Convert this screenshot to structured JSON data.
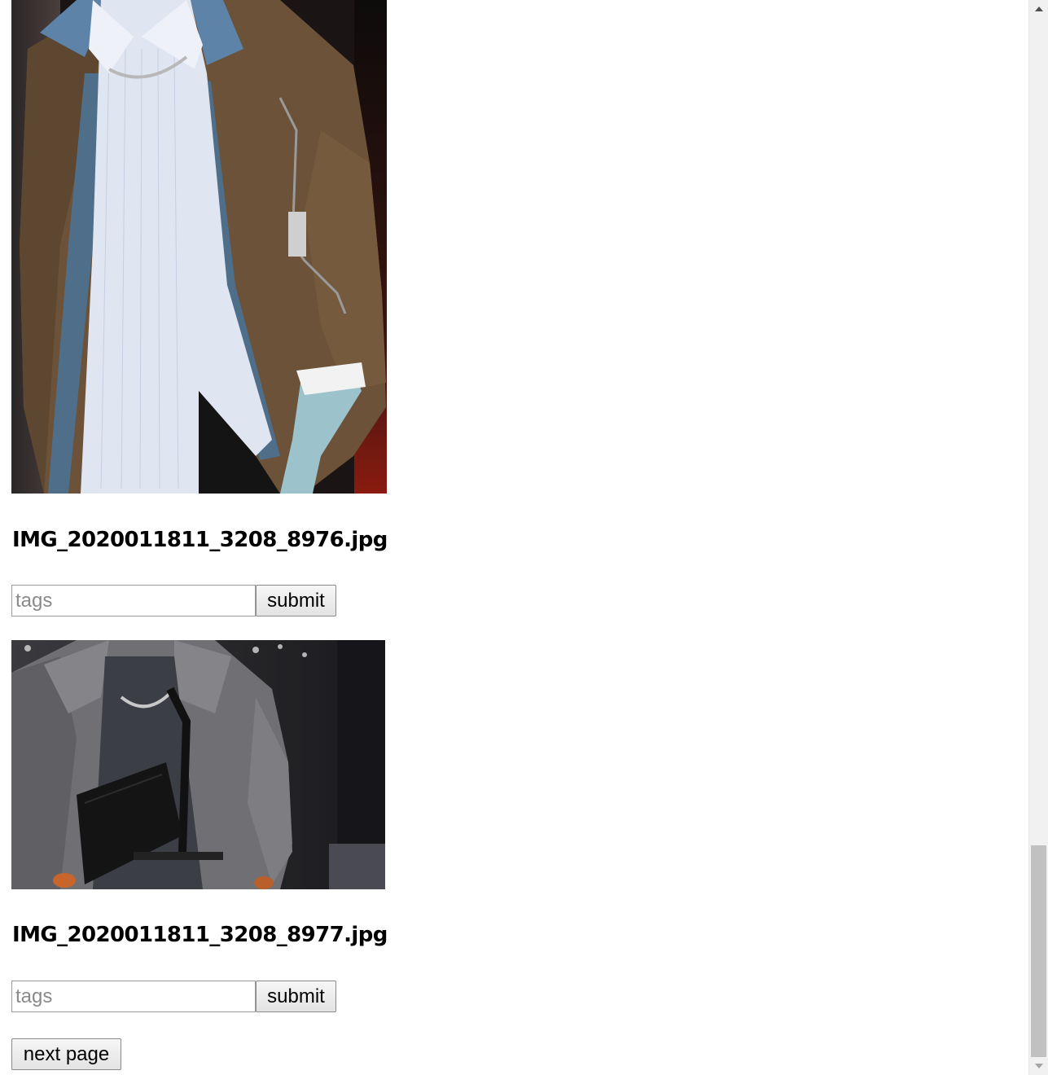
{
  "items": [
    {
      "filename": "IMG_2020011811_3208_8976.jpg",
      "tags_placeholder": "tags",
      "submit_label": "submit"
    },
    {
      "filename": "IMG_2020011811_3208_8977.jpg",
      "tags_placeholder": "tags",
      "submit_label": "submit"
    }
  ],
  "pagination": {
    "next_label": "next page"
  },
  "colors": {
    "coat_brown": "#6b5238",
    "shirt_blue": "#dfe6f2",
    "collar_denim": "#5d83a8",
    "glove_blue": "#9cc3cc",
    "fur_grey": "#6f6f74",
    "bag_black": "#141414"
  }
}
